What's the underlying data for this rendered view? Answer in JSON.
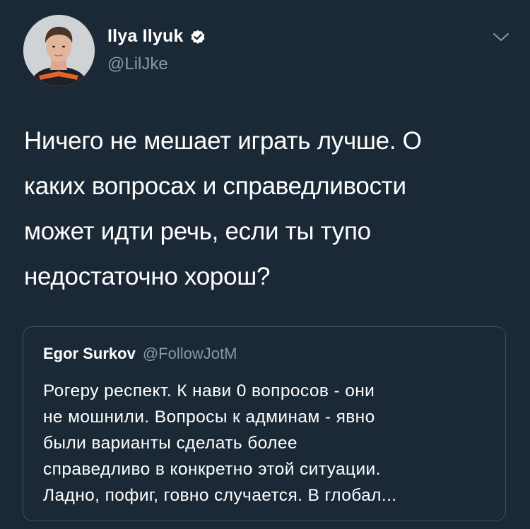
{
  "author": {
    "display_name": "Ilya Ilyuk",
    "handle": "@LilJke",
    "verified": true,
    "avatar": "profile-photo"
  },
  "tweet": {
    "lines": [
      "Ничего не мешает играть лучше. О",
      "каких вопросах и справедливости",
      "может идти речь, если ты тупо",
      "недостаточно хорош?"
    ]
  },
  "quoted_tweet": {
    "display_name": "Egor Surkov",
    "handle": "@FollowJotM",
    "lines": [
      "Рогеру респект. К нави 0 вопросов - они",
      "не мошнили. Вопросы к админам - явно",
      "были варианты сделать более",
      "справедливо в конкретно этой ситуации.",
      "Ладно, пофиг, говно случается. В глобал..."
    ]
  },
  "icons": {
    "verified": "verified-badge-icon",
    "menu": "chevron-down-icon"
  },
  "colors": {
    "background": "#1b2836",
    "secondary_text": "#8899a6",
    "card_border": "#3d5466"
  }
}
